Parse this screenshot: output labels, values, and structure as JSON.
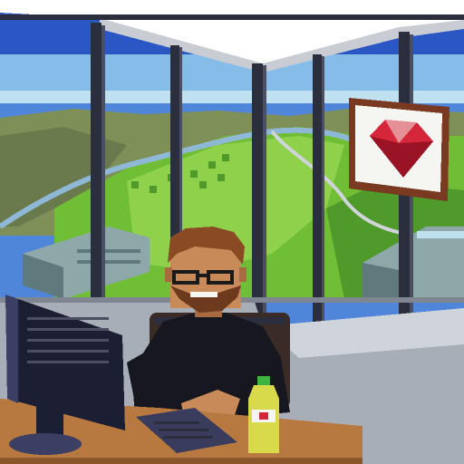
{
  "scene": {
    "description_free": true,
    "colors": {
      "sky_top": "#2a57c4",
      "sky_mid": "#4f86d9",
      "sky_low": "#86bde8",
      "haze": "#bfe0ee",
      "hill_dark": "#6b7a4c",
      "hill_mid": "#7f8f58",
      "park_light": "#8fd14a",
      "park_mid": "#6fbe36",
      "park_dark": "#4f9a2b",
      "water": "#8fb8d6",
      "building": "#8ea7a8",
      "building_dark": "#5f7a7c",
      "frame": "#2b2f3d",
      "frame_light": "#4a4f63",
      "ceiling": "#ffffff",
      "ceiling_shadow": "#c9ccd2",
      "floor": "#a7aeb7",
      "floor_light": "#cfd4da",
      "wall_shadow": "#7d8691",
      "desk": "#b7793f",
      "desk_dark": "#8b552a",
      "monitor": "#1c1f33",
      "monitor_edge": "#3b3f63",
      "keyboard": "#3a3c5e",
      "chair": "#3b2b27",
      "shirt": "#17181f",
      "skin": "#c98a5a",
      "skin_shadow": "#a86a42",
      "hair": "#8a4a24",
      "beard": "#6e3a1d",
      "glasses": "#1a1a1a",
      "bottle": "#d8d94b",
      "bottle_cap": "#3fb33f",
      "ruby": "#d4283a",
      "ruby_dark": "#9a1324",
      "picture_frame": "#7a3a22",
      "picture_bg": "#f5f5f2"
    },
    "icons": [
      "ruby-gem-icon",
      "monitor-icon",
      "keyboard-icon",
      "bottle-icon"
    ]
  }
}
